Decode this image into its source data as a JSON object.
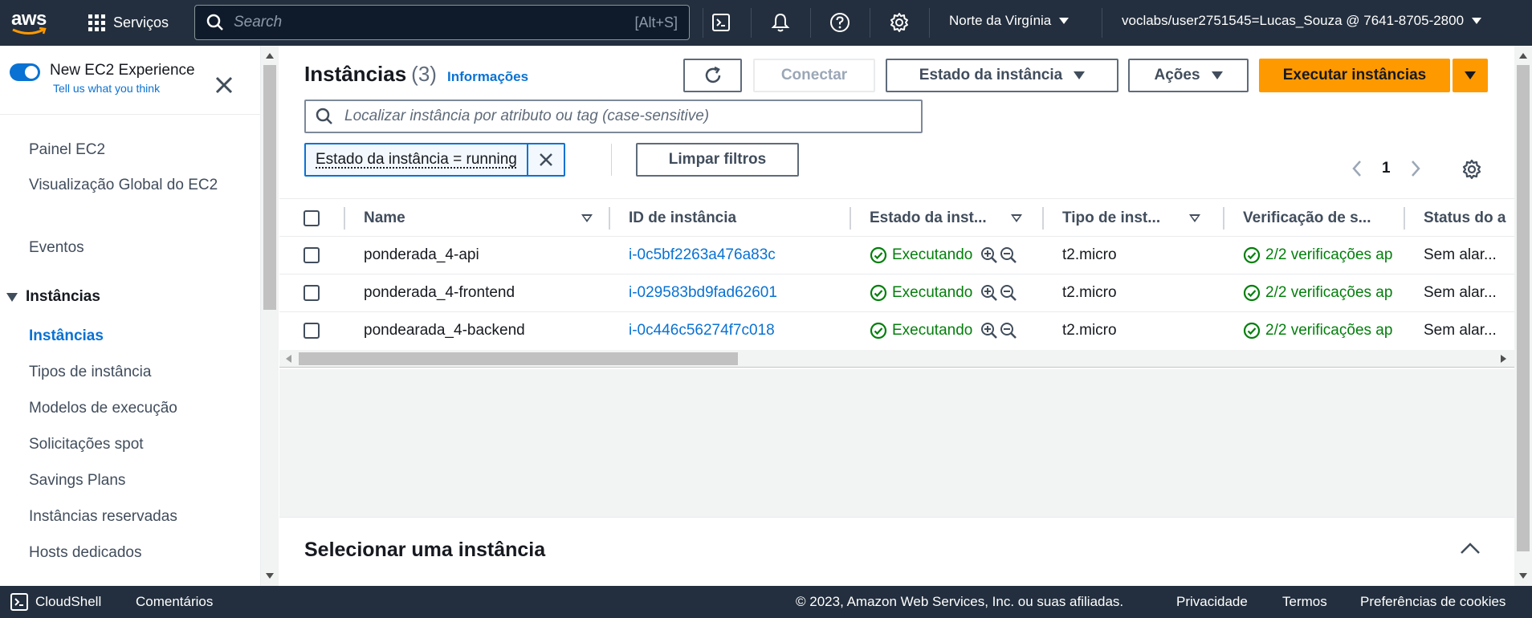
{
  "topnav": {
    "logo_text": "aws",
    "services_label": "Serviços",
    "search_placeholder": "Search",
    "search_shortcut": "[Alt+S]",
    "region": "Norte da Virgínia",
    "account": "voclabs/user2751545=Lucas_Souza @ 7641-8705-2800",
    "icons": [
      "cloudshell-icon",
      "bell-icon",
      "help-icon",
      "gear-icon"
    ]
  },
  "sidebar": {
    "experience_title": "New EC2 Experience",
    "experience_link": "Tell us what you think",
    "items": [
      {
        "label": "Painel EC2"
      },
      {
        "label": "Visualização Global do EC2"
      },
      {
        "label": "Eventos"
      }
    ],
    "section": "Instâncias",
    "section_items": [
      {
        "label": "Instâncias",
        "active": true
      },
      {
        "label": "Tipos de instância"
      },
      {
        "label": "Modelos de execução"
      },
      {
        "label": "Solicitações spot"
      },
      {
        "label": "Savings Plans"
      },
      {
        "label": "Instâncias reservadas"
      },
      {
        "label": "Hosts dedicados"
      }
    ]
  },
  "main": {
    "title": "Instâncias",
    "count": "(3)",
    "info_link": "Informações",
    "buttons": {
      "connect": "Conectar",
      "state": "Estado da instância",
      "actions": "Ações",
      "launch": "Executar instâncias"
    },
    "filter_placeholder": "Localizar instância por atributo ou tag (case-sensitive)",
    "filter_token": "Estado da instância = running",
    "clear_filters": "Limpar filtros",
    "page": "1",
    "columns": [
      "Name",
      "ID de instância",
      "Estado da inst...",
      "Tipo de inst...",
      "Verificação de s...",
      "Status do a"
    ],
    "rows": [
      {
        "name": "ponderada_4-api",
        "id": "i-0c5bf2263a476a83c",
        "state": "Executando",
        "type": "t2.micro",
        "check": "2/2 verificações ap",
        "alarm": "Sem alar..."
      },
      {
        "name": "ponderada_4-frontend",
        "id": "i-029583bd9fad62601",
        "state": "Executando",
        "type": "t2.micro",
        "check": "2/2 verificações ap",
        "alarm": "Sem alar..."
      },
      {
        "name": "pondearada_4-backend",
        "id": "i-0c446c56274f7c018",
        "state": "Executando",
        "type": "t2.micro",
        "check": "2/2 verificações ap",
        "alarm": "Sem alar..."
      }
    ],
    "select_panel_title": "Selecionar uma instância"
  },
  "footer": {
    "cloudshell": "CloudShell",
    "comments": "Comentários",
    "copyright": "© 2023, Amazon Web Services, Inc. ou suas afiliadas.",
    "privacy": "Privacidade",
    "terms": "Termos",
    "cookies": "Preferências de cookies"
  },
  "colors": {
    "nav_bg": "#232f3e",
    "link": "#0972d3",
    "primary": "#ff9900",
    "success": "#037f0c"
  }
}
